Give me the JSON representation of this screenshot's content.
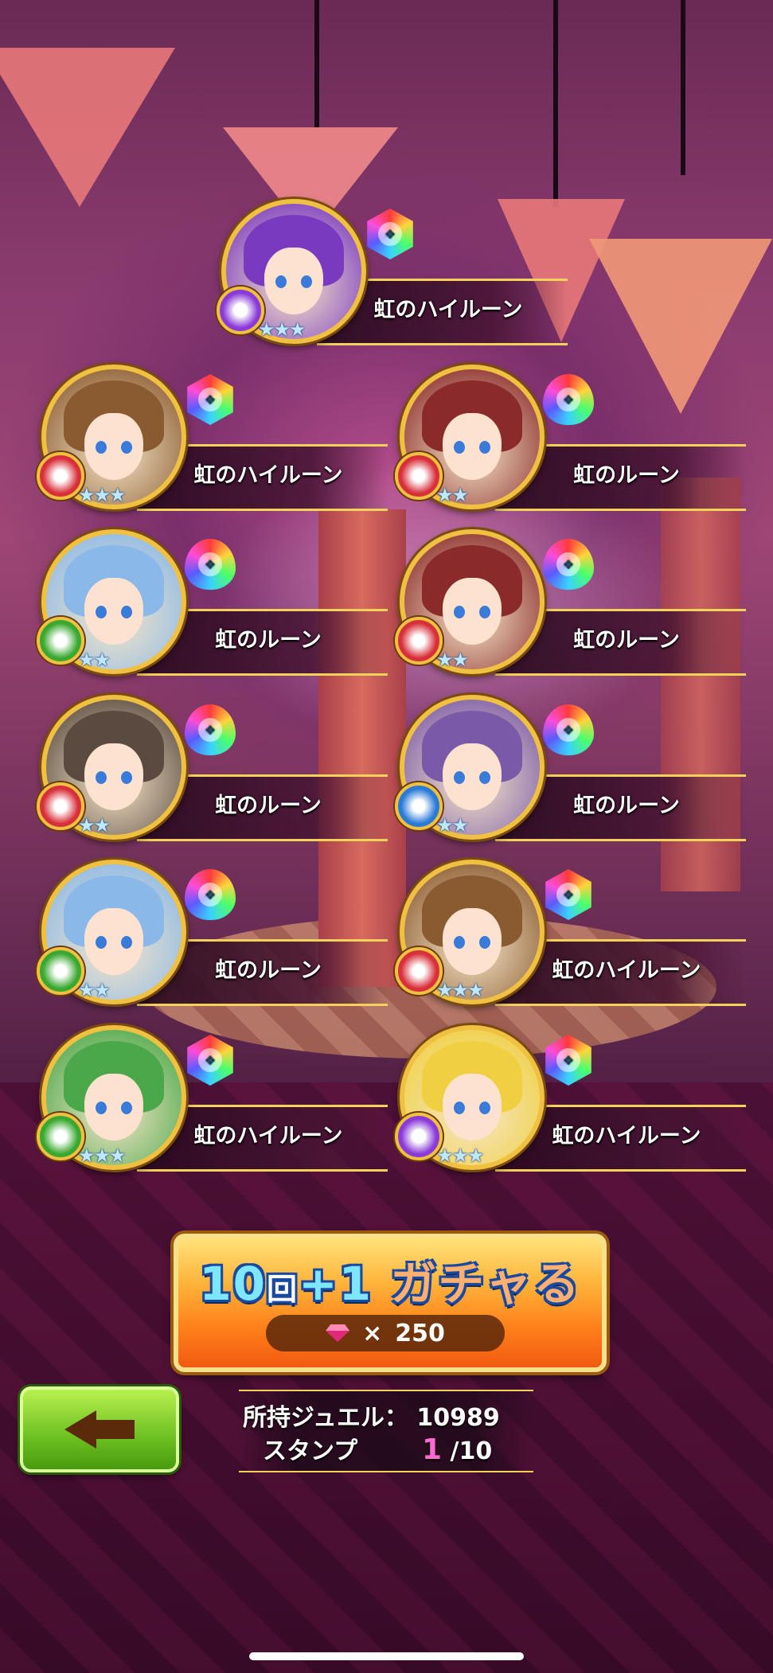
{
  "results": [
    {
      "name": "虹のハイルーン",
      "stars": "★★★",
      "rune": "hex",
      "element": "dark",
      "element_color": "#8a3ad8",
      "hair_color": "#7a3ac0"
    },
    {
      "name": "虹のハイルーン",
      "stars": "★★★",
      "rune": "hex",
      "element": "fire",
      "element_color": "#d8303a",
      "hair_color": "#8a5a30"
    },
    {
      "name": "虹のルーン",
      "stars": "★★",
      "rune": "drop",
      "element": "fire",
      "element_color": "#d8303a",
      "hair_color": "#8a2a2a"
    },
    {
      "name": "虹のルーン",
      "stars": "★★",
      "rune": "drop",
      "element": "wind",
      "element_color": "#3aa830",
      "hair_color": "#8ab8e8"
    },
    {
      "name": "虹のルーン",
      "stars": "★★",
      "rune": "drop",
      "element": "fire",
      "element_color": "#d8303a",
      "hair_color": "#8a2a2a"
    },
    {
      "name": "虹のルーン",
      "stars": "★★",
      "rune": "drop",
      "element": "fire",
      "element_color": "#d8303a",
      "hair_color": "#5a4a40"
    },
    {
      "name": "虹のルーン",
      "stars": "★★",
      "rune": "drop",
      "element": "water",
      "element_color": "#2a7ad8",
      "hair_color": "#7a5aa8"
    },
    {
      "name": "虹のルーン",
      "stars": "★★",
      "rune": "drop",
      "element": "wind",
      "element_color": "#3aa830",
      "hair_color": "#8ab8e8"
    },
    {
      "name": "虹のハイルーン",
      "stars": "★★★",
      "rune": "hex",
      "element": "fire",
      "element_color": "#d8303a",
      "hair_color": "#8a5a30"
    },
    {
      "name": "虹のハイルーン",
      "stars": "★★★",
      "rune": "hex",
      "element": "wind",
      "element_color": "#3aa830",
      "hair_color": "#4aa84a"
    },
    {
      "name": "虹のハイルーン",
      "stars": "★★★",
      "rune": "hex",
      "element": "dark",
      "element_color": "#8a3ad8",
      "hair_color": "#f0d040"
    }
  ],
  "gacha_button": {
    "title_num": "10",
    "title_kai": "回",
    "title_plus": "+1",
    "title_kana": "ガチャる",
    "cost_x": "×",
    "cost": "250"
  },
  "info": {
    "jewel_label": "所持ジュエル：",
    "jewel_value": "10989",
    "stamp_label": "スタンプ",
    "stamp_current": "1",
    "stamp_total": "/10"
  },
  "icons": {
    "back": "left-arrow-icon",
    "gem": "gem-icon",
    "rune_center": "rune-symbol-icon"
  }
}
